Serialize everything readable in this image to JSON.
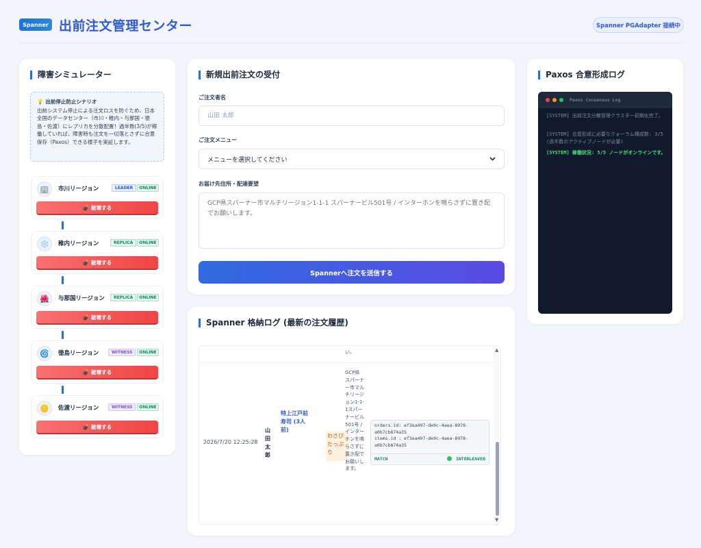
{
  "header": {
    "logo": "Spanner",
    "title": "出前注文管理センター",
    "status": "Spanner PGAdapter 接続中"
  },
  "simulator": {
    "title": "障害シミュレーター",
    "scenario_title": "出前停止防止シナリオ",
    "scenario_text": "出前システム停止による注文ロスを防ぐため、日本全国のデータセンター（市川・稚内・与那国・徳島・佐渡）にレプリカを分散配置！過半数(3/5)が稼働していれば、障害時も注文を一切落とさずに合意保存（Paxos）できる様子を実証します。",
    "nodes": [
      {
        "icon": "🏢",
        "name": "市川リージョン",
        "role": "LEADER",
        "status": "ONLINE",
        "action": "破壊する"
      },
      {
        "icon": "❄️",
        "name": "稚内リージョン",
        "role": "REPLICA",
        "status": "ONLINE",
        "action": "破壊する"
      },
      {
        "icon": "🌺",
        "name": "与那国リージョン",
        "role": "REPLICA",
        "status": "ONLINE",
        "action": "破壊する"
      },
      {
        "icon": "🌀",
        "name": "徳島リージョン",
        "role": "WITNESS",
        "status": "ONLINE",
        "action": "破壊する"
      },
      {
        "icon": "🪙",
        "name": "佐渡リージョン",
        "role": "WITNESS",
        "status": "ONLINE",
        "action": "破壊する"
      }
    ]
  },
  "order_form": {
    "title": "新規出前注文の受付",
    "name_label": "ご注文者名",
    "name_placeholder": "山田 太郎",
    "menu_label": "ご注文メニュー",
    "menu_selected": "メニューを選択してください",
    "address_label": "お届け先住所・配達要望",
    "address_placeholder": "GCP県スパーナー市マルチリージョン1-1-1 スパーナービル501号 / インターホンを鳴らさずに置き配でお願いします。",
    "submit": "Spannerへ注文を送信する"
  },
  "log": {
    "title": "Spanner 格納ログ (最新の注文履歴)",
    "prev_tail": "い。",
    "row": {
      "time": "2026/7/20 12:25:28",
      "name": "山田太郎",
      "menu": "特上江戸前寿司 (3人前)",
      "option": "わさびたっぷり",
      "address": "GCP県スパーナー市マルチリージョン1-1-1スパーナービル501号 / インターホンを鳴らさずに置き配でお願いします。",
      "key1": "orders.id: ef3ea497-de0c-4aea-8978-a0b7cb874a35",
      "key2": "items.id : ef3ea497-de0c-4aea-8978-a0b7cb874a35",
      "match": "MATCH",
      "interleaved": "INTERLEAVED"
    }
  },
  "paxos": {
    "title": "Paxos 合意形成ログ",
    "terminal_title": "Paxos Consensus Log",
    "lines": [
      "[SYSTEM] 出前注文分散管理クラスター初期化完了。",
      "[SYSTEM] 合意形成に必要なクォーラム構成数: 3/5 (過半数のアクティブノードが必要)",
      "[SYSTEM] 稼働状況: 5/5 ノードがオンラインです。"
    ]
  }
}
